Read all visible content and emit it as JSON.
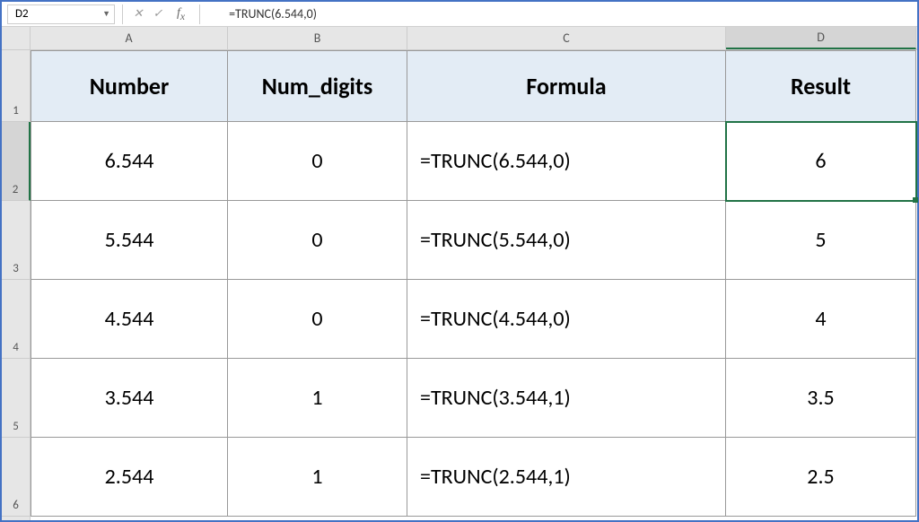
{
  "nameBox": {
    "value": "D2"
  },
  "formulaBar": {
    "value": "=TRUNC(6.544,0)"
  },
  "columns": [
    {
      "label": "A",
      "class": "c-A"
    },
    {
      "label": "B",
      "class": "c-B"
    },
    {
      "label": "C",
      "class": "c-C"
    },
    {
      "label": "D",
      "class": "c-D"
    }
  ],
  "rowLabels": [
    "1",
    "2",
    "3",
    "4",
    "5",
    "6"
  ],
  "headers": {
    "A": "Number",
    "B": "Num_digits",
    "C": "Formula",
    "D": "Result"
  },
  "rows": [
    {
      "A": "6.544",
      "B": "0",
      "C": "=TRUNC(6.544,0)",
      "D": "6"
    },
    {
      "A": "5.544",
      "B": "0",
      "C": "=TRUNC(5.544,0)",
      "D": "5"
    },
    {
      "A": "4.544",
      "B": "0",
      "C": "=TRUNC(4.544,0)",
      "D": "4"
    },
    {
      "A": "3.544",
      "B": "1",
      "C": "=TRUNC(3.544,1)",
      "D": "3.5"
    },
    {
      "A": "2.544",
      "B": "1",
      "C": "=TRUNC(2.544,1)",
      "D": "2.5"
    }
  ],
  "activeCell": {
    "row": 0,
    "col": "D"
  }
}
